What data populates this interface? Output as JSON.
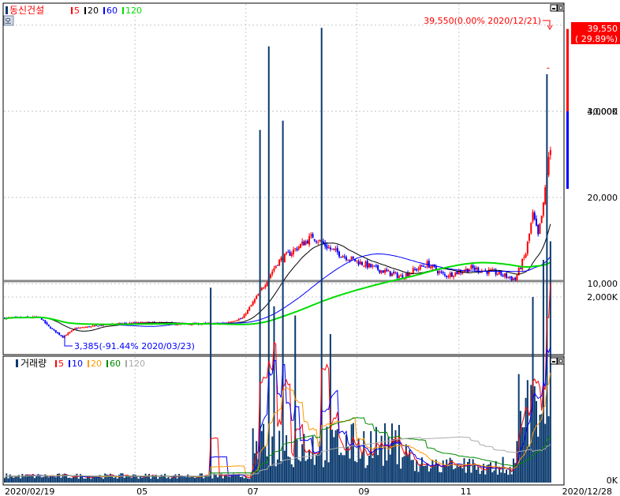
{
  "price_panel": {
    "stock_name": "동신건설",
    "ma_legend": [
      {
        "label": "5",
        "color": "#ff0000"
      },
      {
        "label": "20",
        "color": "#000000"
      },
      {
        "label": "60",
        "color": "#0000ff"
      },
      {
        "label": "120",
        "color": "#00dd00"
      }
    ],
    "side_button": "오",
    "high_annotation": "39,550(0.00% 2020/12/21)",
    "low_annotation": "3,385(-91.44% 2020/03/23)",
    "current_price": "39,550",
    "current_change": "( 29.89%)",
    "y_ticks": [
      {
        "value": 30000,
        "label": "30,000"
      },
      {
        "value": 20000,
        "label": "20,000"
      },
      {
        "value": 10000,
        "label": "10,000"
      }
    ],
    "reference_line": 10300,
    "colors": {
      "up": "#ff0000",
      "down": "#0000ff"
    }
  },
  "volume_panel": {
    "title": "거래량",
    "ma_legend": [
      {
        "label": "5",
        "color": "#ff0000"
      },
      {
        "label": "10",
        "color": "#0000ff"
      },
      {
        "label": "20",
        "color": "#ff9900"
      },
      {
        "label": "60",
        "color": "#008800"
      },
      {
        "label": "120",
        "color": "#aaaaaa"
      }
    ],
    "y_ticks": [
      {
        "value": 4000,
        "label": "4,000K"
      },
      {
        "value": 2000,
        "label": "2,000K"
      },
      {
        "value": 0,
        "label": "0K"
      }
    ],
    "bar_color": "#0a3a6e"
  },
  "x_axis": {
    "start_label": "2020/02/19",
    "month_labels": [
      {
        "day": 74,
        "label": "05"
      },
      {
        "day": 137,
        "label": "07"
      },
      {
        "day": 200,
        "label": "09"
      },
      {
        "day": 258,
        "label": "11"
      }
    ],
    "end_label": "2020/12/28"
  },
  "chart_data": [
    {
      "type": "candlestick",
      "title": "동신건설",
      "x_start": "2020-02-19",
      "x_end": "2020-12-28",
      "ylim": [
        0,
        42000
      ],
      "y_scale": "linear",
      "grid": true,
      "legend": "top-left",
      "price_keypoints": [
        {
          "day": 0,
          "close": 6000
        },
        {
          "day": 20,
          "close": 6100
        },
        {
          "day": 25,
          "close": 5000
        },
        {
          "day": 33,
          "close": 3800
        },
        {
          "day": 40,
          "close": 4800
        },
        {
          "day": 60,
          "close": 5300
        },
        {
          "day": 80,
          "close": 5500
        },
        {
          "day": 100,
          "close": 5300
        },
        {
          "day": 125,
          "close": 5400
        },
        {
          "day": 135,
          "close": 6000
        },
        {
          "day": 145,
          "close": 9000
        },
        {
          "day": 155,
          "close": 12500
        },
        {
          "day": 165,
          "close": 14000
        },
        {
          "day": 175,
          "close": 15500
        },
        {
          "day": 185,
          "close": 14000
        },
        {
          "day": 195,
          "close": 13000
        },
        {
          "day": 210,
          "close": 11800
        },
        {
          "day": 225,
          "close": 10800
        },
        {
          "day": 240,
          "close": 12300
        },
        {
          "day": 250,
          "close": 10900
        },
        {
          "day": 265,
          "close": 11800
        },
        {
          "day": 280,
          "close": 11200
        },
        {
          "day": 290,
          "close": 10500
        },
        {
          "day": 296,
          "close": 13500
        },
        {
          "day": 300,
          "close": 18000
        },
        {
          "day": 303,
          "close": 15500
        },
        {
          "day": 306,
          "close": 19000
        },
        {
          "day": 308,
          "close": 23000
        },
        {
          "day": 310,
          "close": 25500
        }
      ],
      "last_close": 39550,
      "high": {
        "value": 39550,
        "date": "2020/12/21"
      },
      "low": {
        "value": 3385,
        "date": "2020/03/23"
      }
    },
    {
      "type": "bar",
      "title": "거래량",
      "units": "K shares",
      "ylim": [
        0,
        5000
      ],
      "spikes": [
        {
          "day": 117,
          "value": 2100
        },
        {
          "day": 145,
          "value": 3800
        },
        {
          "day": 150,
          "value": 4700
        },
        {
          "day": 153,
          "value": 1900
        },
        {
          "day": 158,
          "value": 3900
        },
        {
          "day": 165,
          "value": 1800
        },
        {
          "day": 180,
          "value": 4900
        },
        {
          "day": 185,
          "value": 1600
        },
        {
          "day": 300,
          "value": 2000
        },
        {
          "day": 306,
          "value": 2400
        },
        {
          "day": 308,
          "value": 4400
        },
        {
          "day": 310,
          "value": 2600
        }
      ]
    }
  ]
}
